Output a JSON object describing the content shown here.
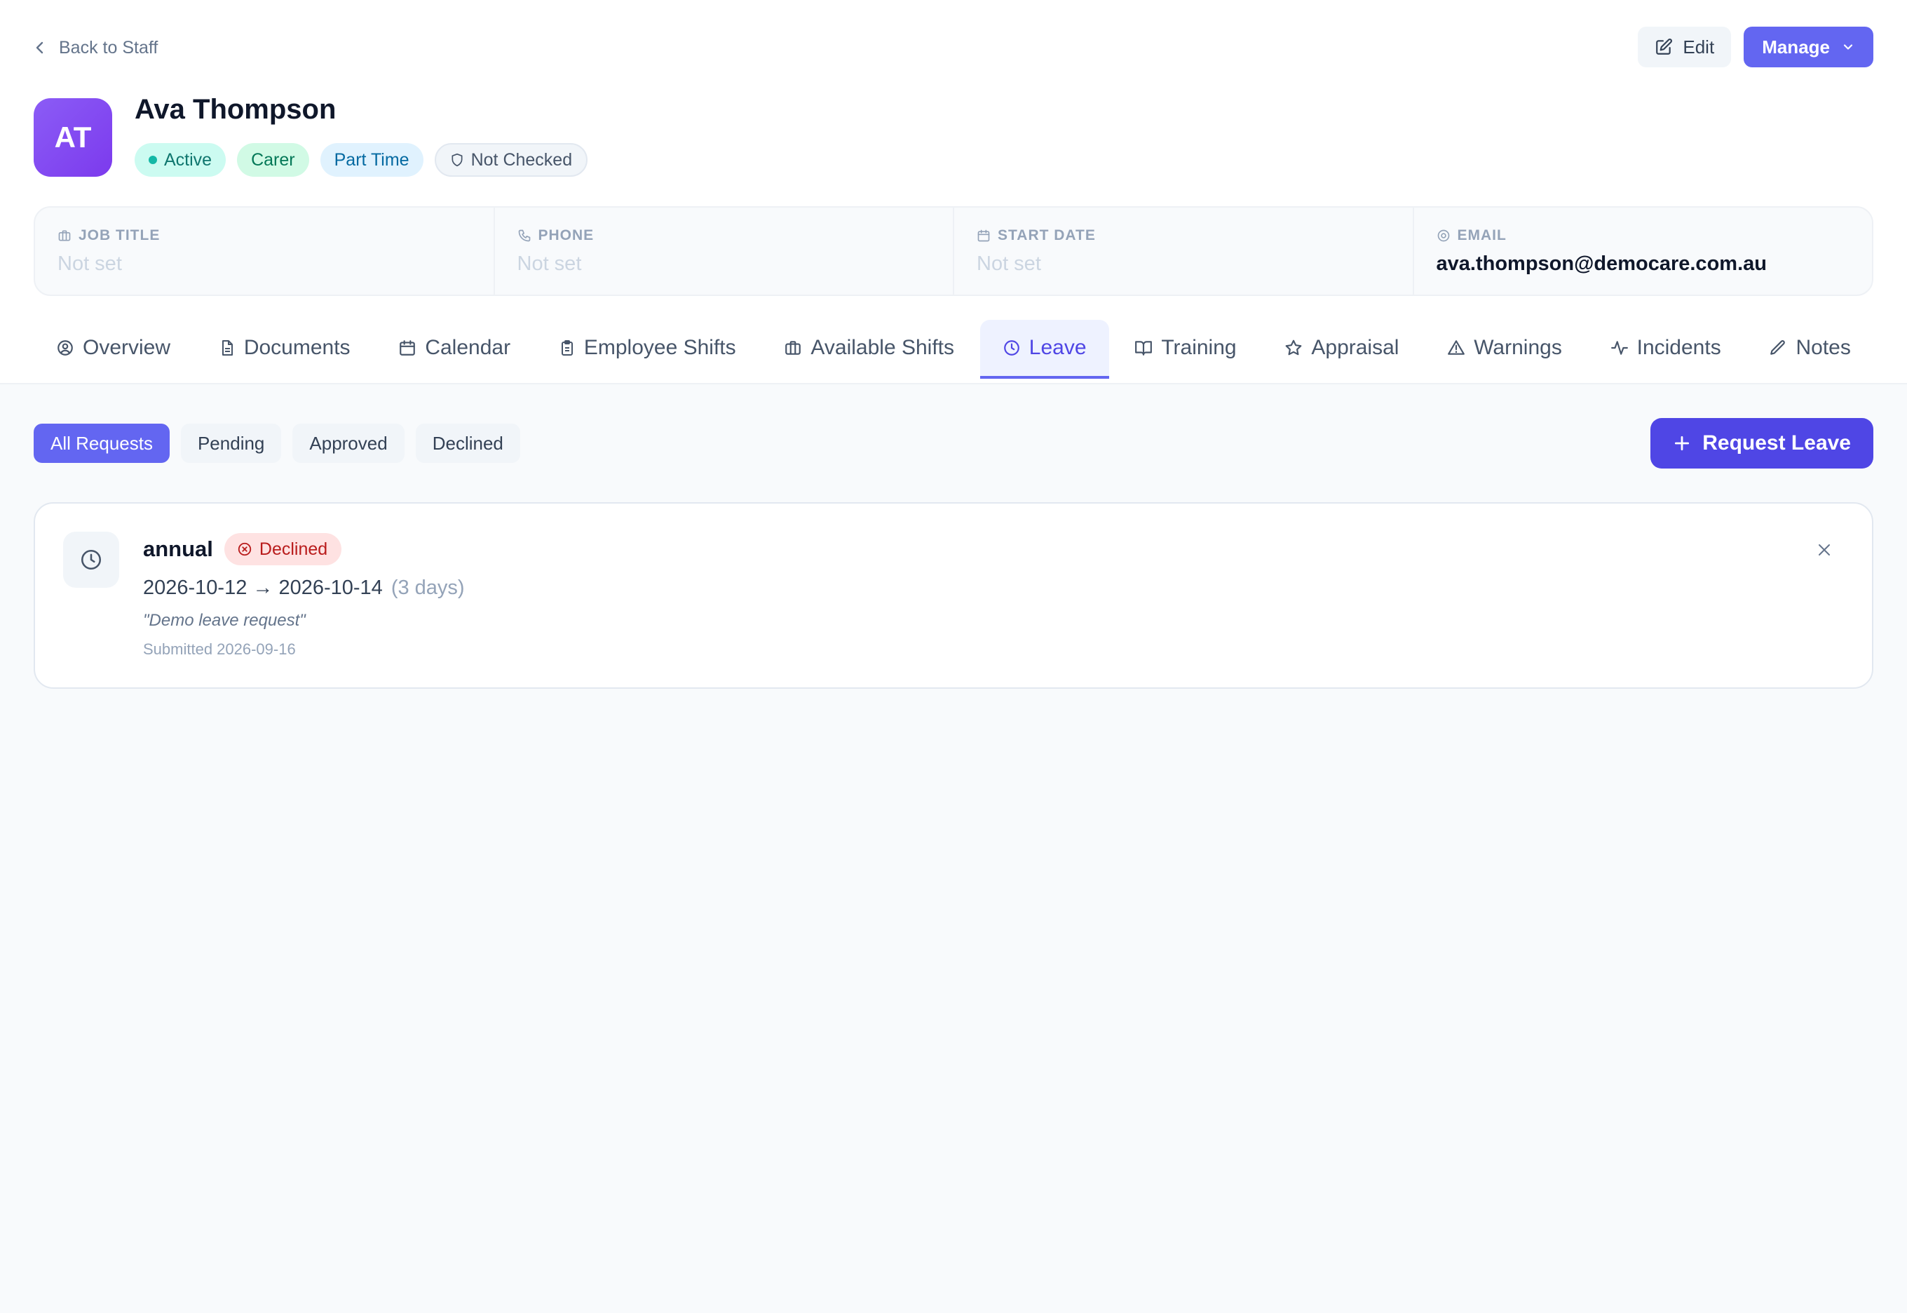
{
  "nav": {
    "back_label": "Back to Staff"
  },
  "actions": {
    "edit_label": "Edit",
    "manage_label": "Manage"
  },
  "profile": {
    "initials": "AT",
    "name": "Ava Thompson",
    "badges": {
      "status": "Active",
      "role": "Carer",
      "employment": "Part Time",
      "check": "Not Checked"
    }
  },
  "info": {
    "job_title": {
      "label": "JOB TITLE",
      "value": "Not set"
    },
    "phone": {
      "label": "PHONE",
      "value": "Not set"
    },
    "start_date": {
      "label": "START DATE",
      "value": "Not set"
    },
    "email": {
      "label": "EMAIL",
      "value": "ava.thompson@democare.com.au"
    }
  },
  "tabs": {
    "overview": "Overview",
    "documents": "Documents",
    "calendar": "Calendar",
    "employee_shifts": "Employee Shifts",
    "available_shifts": "Available Shifts",
    "leave": "Leave",
    "training": "Training",
    "appraisal": "Appraisal",
    "warnings": "Warnings",
    "incidents": "Incidents",
    "notes": "Notes",
    "active": "leave"
  },
  "filters": {
    "all": "All Requests",
    "pending": "Pending",
    "approved": "Approved",
    "declined": "Declined",
    "active": "all"
  },
  "request_button": "Request Leave",
  "leave_requests": [
    {
      "type": "annual",
      "status": "Declined",
      "date_range": "2026-10-12 → 2026-10-14",
      "duration": "(3 days)",
      "reason": "\"Demo leave request\"",
      "submitted": "Submitted 2026-09-16"
    }
  ],
  "colors": {
    "accent": "#6366f1",
    "declined": "#b91c1c",
    "active_status": "#14b8a6"
  }
}
